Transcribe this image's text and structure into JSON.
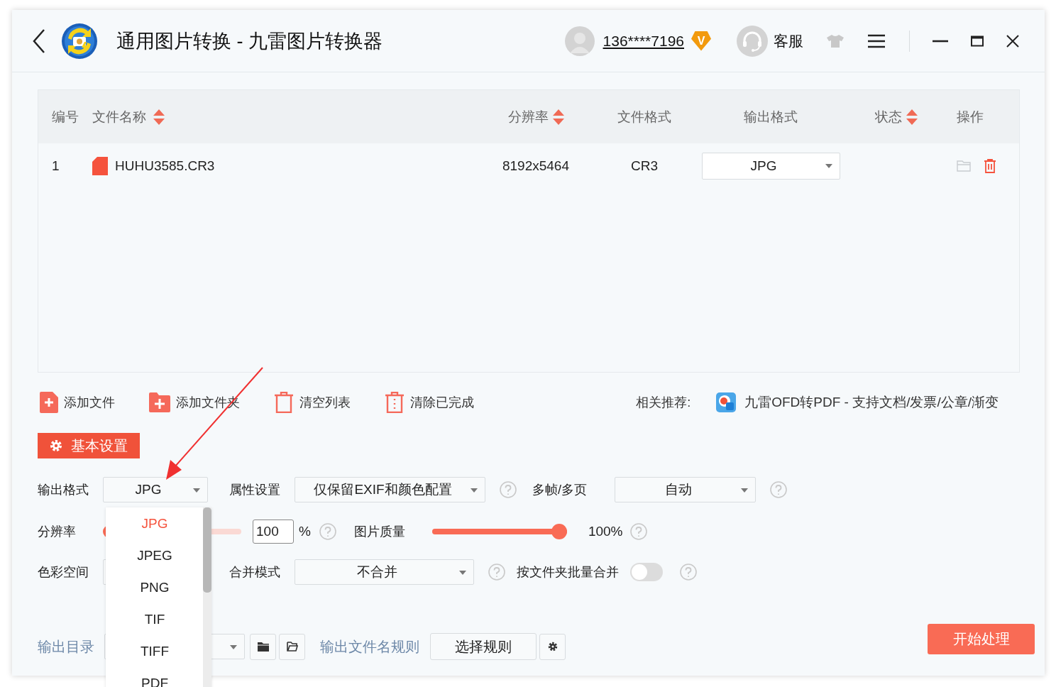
{
  "window": {
    "title": "通用图片转换 - 九雷图片转换器",
    "account": "136****7196",
    "vip_badge": "V",
    "support": "客服"
  },
  "table": {
    "columns": [
      {
        "label": "编号",
        "sortable": false
      },
      {
        "label": "文件名称",
        "sortable": true
      },
      {
        "label": "分辨率",
        "sortable": true
      },
      {
        "label": "文件格式",
        "sortable": false
      },
      {
        "label": "输出格式",
        "sortable": false
      },
      {
        "label": "状态",
        "sortable": true
      },
      {
        "label": "操作",
        "sortable": false
      }
    ],
    "rows": [
      {
        "index": "1",
        "name": "HUHU3585.CR3",
        "resolution": "8192x5464",
        "format": "CR3",
        "output": "JPG"
      }
    ]
  },
  "toolbar": {
    "items": [
      {
        "kind": "add-file",
        "label": "添加文件"
      },
      {
        "kind": "add-folder",
        "label": "添加文件夹"
      },
      {
        "kind": "clear",
        "label": "清空列表"
      },
      {
        "kind": "clear-done",
        "label": "清除已完成"
      }
    ],
    "recommend_label": "相关推荐:",
    "recommend_link": "九雷OFD转PDF - 支持文档/发票/公章/渐变"
  },
  "settings": {
    "title": "基本设置",
    "output_format": {
      "label": "输出格式",
      "value": "JPG",
      "options": [
        {
          "label": "JPG",
          "selected": true
        },
        {
          "label": "JPEG",
          "selected": false
        },
        {
          "label": "PNG",
          "selected": false
        },
        {
          "label": "TIF",
          "selected": false
        },
        {
          "label": "TIFF",
          "selected": false
        },
        {
          "label": "PDF",
          "selected": false
        }
      ]
    },
    "attributes": {
      "label": "属性设置",
      "value": "仅保留EXIF和颜色配置"
    },
    "multi_frame": {
      "label": "多帧/多页",
      "value": "自动"
    },
    "resolution": {
      "label": "分辨率",
      "level": 0,
      "value": "100",
      "unit": "%"
    },
    "quality": {
      "label": "图片质量",
      "level": 1,
      "reading": "100%"
    },
    "color_space": {
      "label": "色彩空间"
    },
    "merge_mode": {
      "label": "合并模式",
      "value": "不合并"
    },
    "folder_merge": {
      "label": "按文件夹批量合并",
      "on": false
    },
    "output_dir": {
      "label": "输出目录"
    },
    "name_rule": {
      "label": "输出文件名规则",
      "button": "选择规则"
    },
    "start": "开始处理"
  }
}
